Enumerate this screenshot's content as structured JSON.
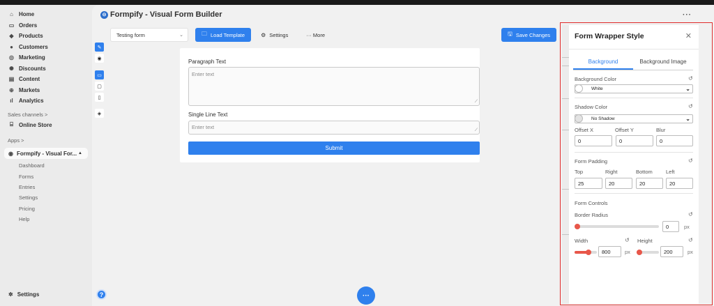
{
  "sidebar": {
    "nav": [
      {
        "label": "Home",
        "icon": "home-icon"
      },
      {
        "label": "Orders",
        "icon": "orders-icon"
      },
      {
        "label": "Products",
        "icon": "tag-icon"
      },
      {
        "label": "Customers",
        "icon": "person-icon"
      },
      {
        "label": "Marketing",
        "icon": "target-icon"
      },
      {
        "label": "Discounts",
        "icon": "discount-icon"
      },
      {
        "label": "Content",
        "icon": "content-icon"
      },
      {
        "label": "Markets",
        "icon": "globe-icon"
      },
      {
        "label": "Analytics",
        "icon": "bar-chart-icon"
      }
    ],
    "sales_channels_label": "Sales channels >",
    "online_store": "Online Store",
    "apps_label": "Apps >",
    "app_name": "Formpify - Visual For...",
    "app_sub": [
      "Dashboard",
      "Forms",
      "Entries",
      "Settings",
      "Pricing",
      "Help"
    ],
    "settings": "Settings"
  },
  "header": {
    "title": "Formpify - Visual Form Builder",
    "more": "···"
  },
  "toolbar": {
    "form_select": "Testing form",
    "load_template": "Load Template",
    "settings": "Settings",
    "more": "··· More",
    "save_changes": "Save Changes"
  },
  "form": {
    "paragraph_label": "Paragraph Text",
    "paragraph_placeholder": "Enter text",
    "single_label": "Single Line Text",
    "single_placeholder": "Enter text",
    "submit": "Submit"
  },
  "panel": {
    "title": "Form Wrapper Style",
    "tabs": [
      "Background",
      "Background Image"
    ],
    "bg_color_label": "Background Color",
    "bg_color_value": "White",
    "shadow_label": "Shadow Color",
    "shadow_value": "No Shadow",
    "offset_x_label": "Offset X",
    "offset_y_label": "Offset Y",
    "blur_label": "Blur",
    "offset_x": "0",
    "offset_y": "0",
    "blur": "0",
    "padding_label": "Form Padding",
    "pad_top_label": "Top",
    "pad_right_label": "Right",
    "pad_bottom_label": "Bottom",
    "pad_left_label": "Left",
    "pad_top": "25",
    "pad_right": "20",
    "pad_bottom": "20",
    "pad_left": "20",
    "controls_label": "Form Controls",
    "radius_label": "Border Radius",
    "radius": "0",
    "width_label": "Width",
    "height_label": "Height",
    "width": "800",
    "height": "200",
    "unit": "px"
  },
  "colors": {
    "accent": "#2f80ed",
    "slider": "#e8574a",
    "highlight": "#e02a2a"
  }
}
